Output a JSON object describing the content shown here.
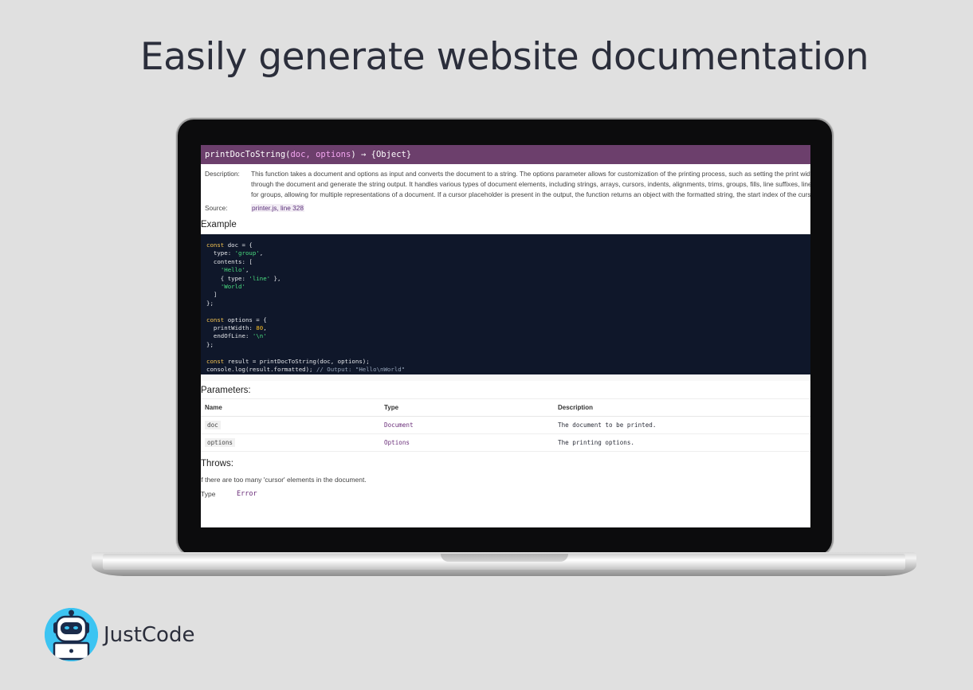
{
  "headline": "Easily generate website documentation",
  "doc": {
    "signature": {
      "name": "printDocToString(",
      "params": "doc, options",
      "close": ")",
      "returns": " → {Object}"
    },
    "description_label": "Description:",
    "description_lines": [
      "This function takes a document and options as input and converts the document to a string. The options parameter allows for customization of the printing process, such as setting the print width a",
      "through the document and generate the string output. It handles various types of document elements, including strings, arrays, cursors, indents, alignments, trims, groups, fills, line suffixes, line br",
      "for groups, allowing for multiple representations of a document. If a cursor placeholder is present in the output, the function returns an object with the formatted string, the start index of the cursor r"
    ],
    "source_label": "Source:",
    "source_link": "printer.js, line 328",
    "example_heading": "Example",
    "parameters_heading": "Parameters:",
    "param_headers": [
      "Name",
      "Type",
      "Description"
    ],
    "param_rows": [
      {
        "name": "doc",
        "type": "Document",
        "desc": "The document to be printed."
      },
      {
        "name": "options",
        "type": "Options",
        "desc": "The printing options."
      }
    ],
    "throws_heading": "Throws:",
    "throws_text": "If there are too many 'cursor' elements in the document.",
    "type_label": "Type",
    "type_value": "Error"
  },
  "brand": {
    "name": "JustCode",
    "logo_icon": "robot-laptop-icon"
  },
  "colors": {
    "signature_bar": "#6c3f6c",
    "code_bg": "#0f172a",
    "background": "#e0e0e0"
  }
}
